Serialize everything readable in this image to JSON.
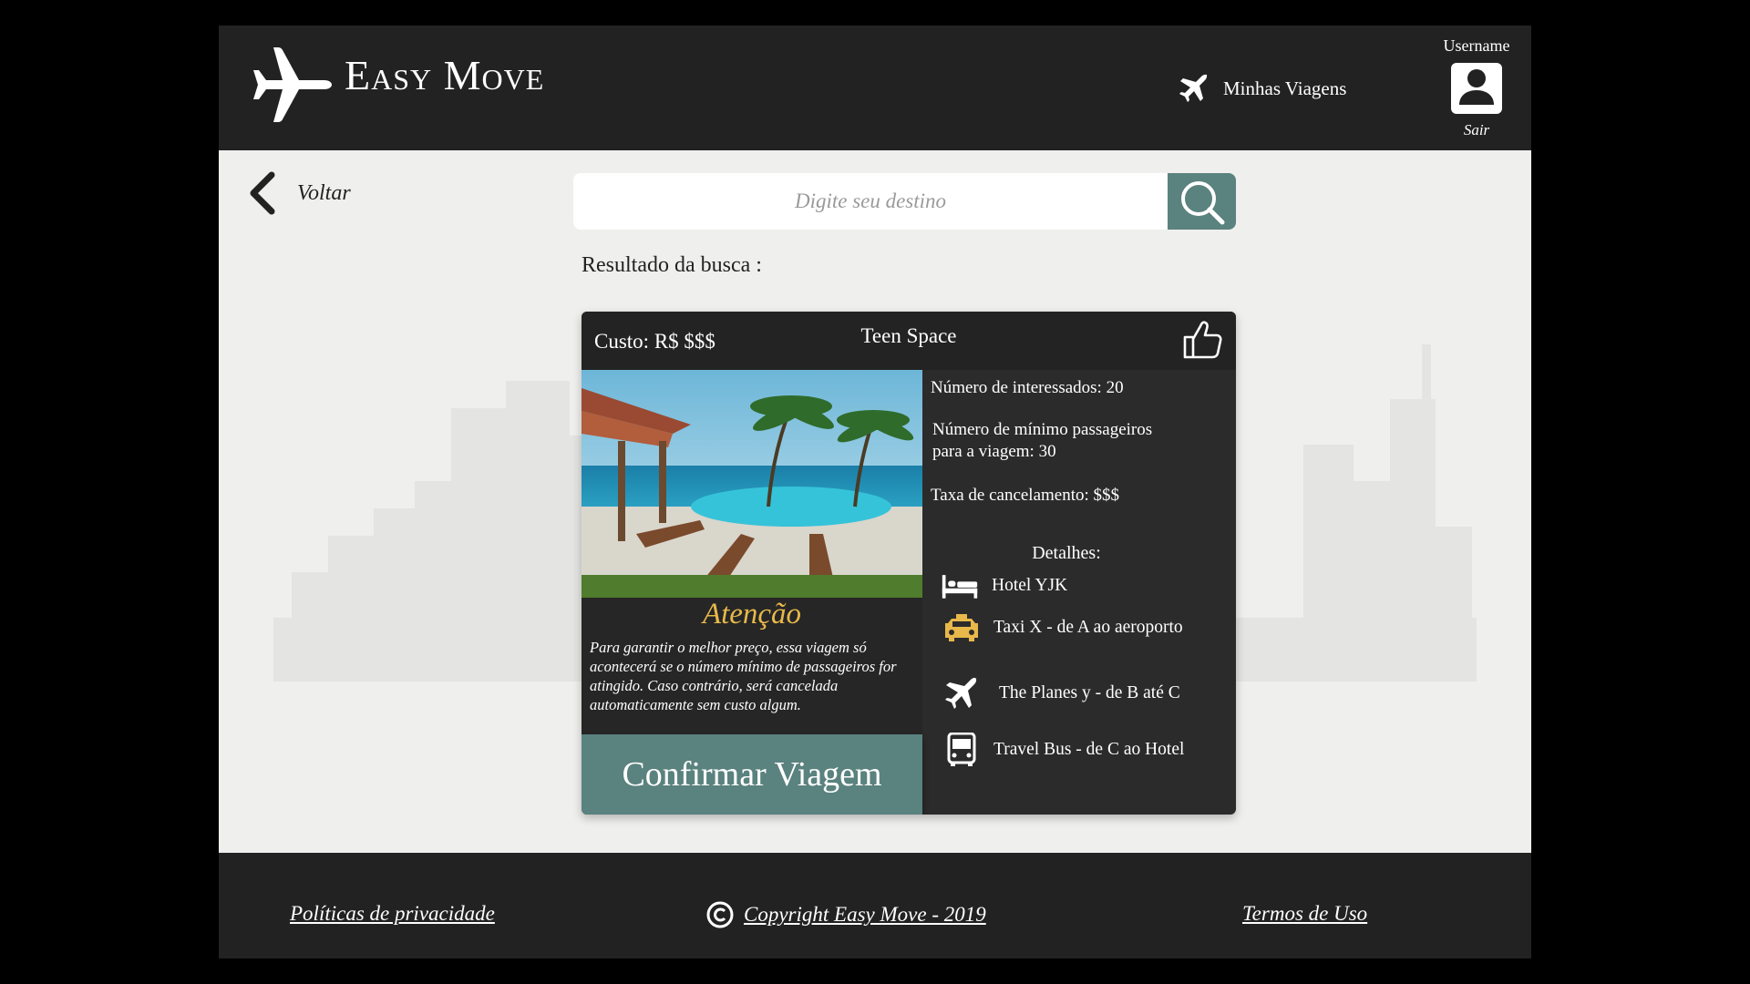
{
  "header": {
    "brand": "Easy Move",
    "nav_trips": "Minhas Viagens",
    "username": "Username",
    "logout": "Sair"
  },
  "back": {
    "label": "Voltar"
  },
  "search": {
    "placeholder": "Digite seu destino",
    "value": ""
  },
  "results": {
    "label": "Resultado da busca :"
  },
  "card": {
    "cost": "Custo: R$ $$$",
    "title": "Teen Space",
    "interested": "Número de interessados: 20",
    "min_passengers_line1": "Número de mínimo passageiros",
    "min_passengers_line2": "para a viagem: 30",
    "cancel_fee": "Taxa de cancelamento:  $$$",
    "details_title": "Detalhes:",
    "details": [
      {
        "icon": "bed-icon",
        "text": "Hotel YJK"
      },
      {
        "icon": "taxi-icon",
        "text": "Taxi X  - de A ao aeroporto"
      },
      {
        "icon": "plane-icon",
        "text": "The Planes y - de B até C"
      },
      {
        "icon": "bus-icon",
        "text": "Travel Bus  - de C ao Hotel"
      }
    ],
    "warning_title": "Atenção",
    "warning_text": "Para garantir o melhor preço, essa viagem só acontecerá se o número mínimo de passageiros for atingido. Caso contrário, será cancelada automaticamente sem custo algum.",
    "confirm_label": "Confirmar Viagem"
  },
  "footer": {
    "privacy": "Políticas de privacidade",
    "copyright": "Copyright Easy Move - 2019",
    "terms": "Termos de Uso"
  },
  "colors": {
    "header_bg": "#222222",
    "accent": "#5a827f",
    "warning": "#e8b84a",
    "page_bg": "#efefed"
  }
}
